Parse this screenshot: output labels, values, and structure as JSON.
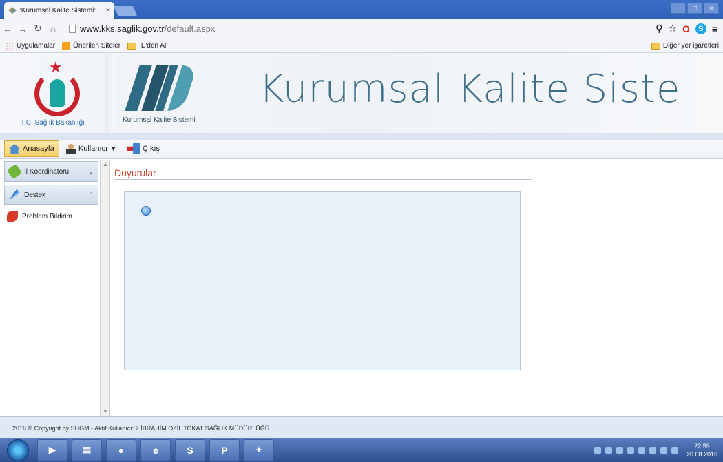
{
  "browser": {
    "tab_title": ":Kurumsal Kalite Sistemi:",
    "tab_close": "×",
    "url_domain": "www.kks.saglik.gov.tr",
    "url_path": "/default.aspx",
    "window_buttons": [
      "−",
      "□",
      "×"
    ]
  },
  "bookmarks": {
    "apps": "Uygulamalar",
    "suggested": "Önerilen Siteler",
    "ie_import": "IE'den Al",
    "other": "Diğer yer işaretleri"
  },
  "header": {
    "ministry_caption": "T.C. Sağlık Bakanlığı",
    "kks_caption": "Kurumsal Kalite Sistemi",
    "big_title": "Kurumsal Kalite Siste"
  },
  "menu": {
    "home": "Anasayfa",
    "user": "Kullanıcı",
    "exit": "Çıkış"
  },
  "sidebar": {
    "section1": "İl Koordinatörü",
    "section2": "Destek",
    "item1": "Problem Bildirim"
  },
  "main": {
    "title": "Duyurular"
  },
  "footer": {
    "text": "2016 © Copyright by SHGM - Aktif Kullanıcı: 2 İBRAHİM OZİL TOKAT SAĞLIK MÜDÜRLÜĞÜ"
  },
  "taskbar": {
    "time": "22:59",
    "date": "20.08.2016"
  }
}
